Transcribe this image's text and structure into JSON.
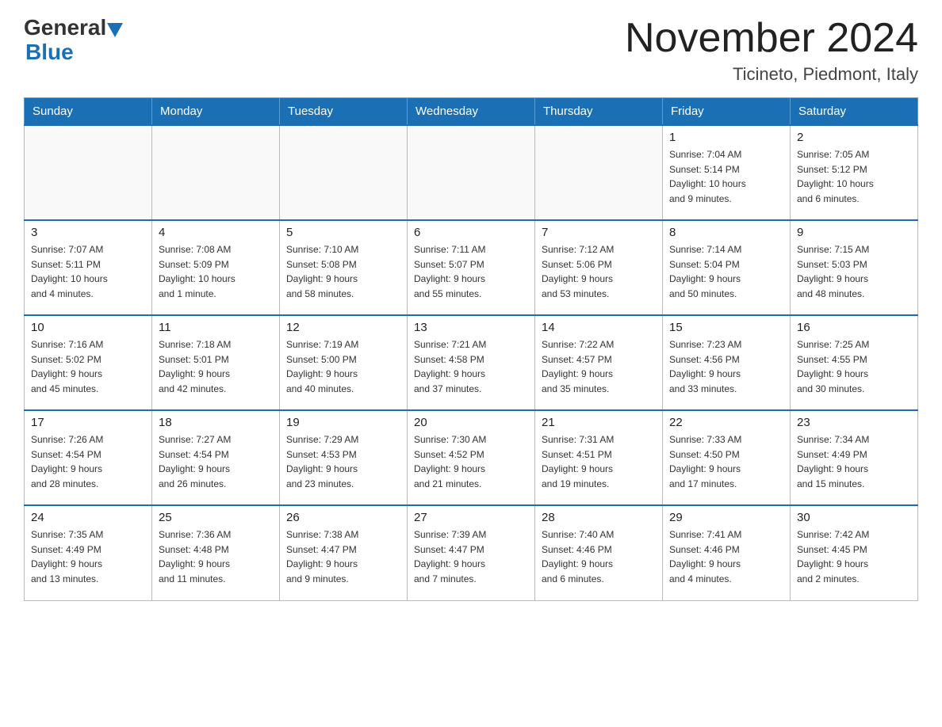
{
  "header": {
    "logo_general": "General",
    "logo_blue": "Blue",
    "main_title": "November 2024",
    "subtitle": "Ticineto, Piedmont, Italy"
  },
  "days_of_week": [
    "Sunday",
    "Monday",
    "Tuesday",
    "Wednesday",
    "Thursday",
    "Friday",
    "Saturday"
  ],
  "weeks": [
    [
      {
        "day": "",
        "info": ""
      },
      {
        "day": "",
        "info": ""
      },
      {
        "day": "",
        "info": ""
      },
      {
        "day": "",
        "info": ""
      },
      {
        "day": "",
        "info": ""
      },
      {
        "day": "1",
        "info": "Sunrise: 7:04 AM\nSunset: 5:14 PM\nDaylight: 10 hours\nand 9 minutes."
      },
      {
        "day": "2",
        "info": "Sunrise: 7:05 AM\nSunset: 5:12 PM\nDaylight: 10 hours\nand 6 minutes."
      }
    ],
    [
      {
        "day": "3",
        "info": "Sunrise: 7:07 AM\nSunset: 5:11 PM\nDaylight: 10 hours\nand 4 minutes."
      },
      {
        "day": "4",
        "info": "Sunrise: 7:08 AM\nSunset: 5:09 PM\nDaylight: 10 hours\nand 1 minute."
      },
      {
        "day": "5",
        "info": "Sunrise: 7:10 AM\nSunset: 5:08 PM\nDaylight: 9 hours\nand 58 minutes."
      },
      {
        "day": "6",
        "info": "Sunrise: 7:11 AM\nSunset: 5:07 PM\nDaylight: 9 hours\nand 55 minutes."
      },
      {
        "day": "7",
        "info": "Sunrise: 7:12 AM\nSunset: 5:06 PM\nDaylight: 9 hours\nand 53 minutes."
      },
      {
        "day": "8",
        "info": "Sunrise: 7:14 AM\nSunset: 5:04 PM\nDaylight: 9 hours\nand 50 minutes."
      },
      {
        "day": "9",
        "info": "Sunrise: 7:15 AM\nSunset: 5:03 PM\nDaylight: 9 hours\nand 48 minutes."
      }
    ],
    [
      {
        "day": "10",
        "info": "Sunrise: 7:16 AM\nSunset: 5:02 PM\nDaylight: 9 hours\nand 45 minutes."
      },
      {
        "day": "11",
        "info": "Sunrise: 7:18 AM\nSunset: 5:01 PM\nDaylight: 9 hours\nand 42 minutes."
      },
      {
        "day": "12",
        "info": "Sunrise: 7:19 AM\nSunset: 5:00 PM\nDaylight: 9 hours\nand 40 minutes."
      },
      {
        "day": "13",
        "info": "Sunrise: 7:21 AM\nSunset: 4:58 PM\nDaylight: 9 hours\nand 37 minutes."
      },
      {
        "day": "14",
        "info": "Sunrise: 7:22 AM\nSunset: 4:57 PM\nDaylight: 9 hours\nand 35 minutes."
      },
      {
        "day": "15",
        "info": "Sunrise: 7:23 AM\nSunset: 4:56 PM\nDaylight: 9 hours\nand 33 minutes."
      },
      {
        "day": "16",
        "info": "Sunrise: 7:25 AM\nSunset: 4:55 PM\nDaylight: 9 hours\nand 30 minutes."
      }
    ],
    [
      {
        "day": "17",
        "info": "Sunrise: 7:26 AM\nSunset: 4:54 PM\nDaylight: 9 hours\nand 28 minutes."
      },
      {
        "day": "18",
        "info": "Sunrise: 7:27 AM\nSunset: 4:54 PM\nDaylight: 9 hours\nand 26 minutes."
      },
      {
        "day": "19",
        "info": "Sunrise: 7:29 AM\nSunset: 4:53 PM\nDaylight: 9 hours\nand 23 minutes."
      },
      {
        "day": "20",
        "info": "Sunrise: 7:30 AM\nSunset: 4:52 PM\nDaylight: 9 hours\nand 21 minutes."
      },
      {
        "day": "21",
        "info": "Sunrise: 7:31 AM\nSunset: 4:51 PM\nDaylight: 9 hours\nand 19 minutes."
      },
      {
        "day": "22",
        "info": "Sunrise: 7:33 AM\nSunset: 4:50 PM\nDaylight: 9 hours\nand 17 minutes."
      },
      {
        "day": "23",
        "info": "Sunrise: 7:34 AM\nSunset: 4:49 PM\nDaylight: 9 hours\nand 15 minutes."
      }
    ],
    [
      {
        "day": "24",
        "info": "Sunrise: 7:35 AM\nSunset: 4:49 PM\nDaylight: 9 hours\nand 13 minutes."
      },
      {
        "day": "25",
        "info": "Sunrise: 7:36 AM\nSunset: 4:48 PM\nDaylight: 9 hours\nand 11 minutes."
      },
      {
        "day": "26",
        "info": "Sunrise: 7:38 AM\nSunset: 4:47 PM\nDaylight: 9 hours\nand 9 minutes."
      },
      {
        "day": "27",
        "info": "Sunrise: 7:39 AM\nSunset: 4:47 PM\nDaylight: 9 hours\nand 7 minutes."
      },
      {
        "day": "28",
        "info": "Sunrise: 7:40 AM\nSunset: 4:46 PM\nDaylight: 9 hours\nand 6 minutes."
      },
      {
        "day": "29",
        "info": "Sunrise: 7:41 AM\nSunset: 4:46 PM\nDaylight: 9 hours\nand 4 minutes."
      },
      {
        "day": "30",
        "info": "Sunrise: 7:42 AM\nSunset: 4:45 PM\nDaylight: 9 hours\nand 2 minutes."
      }
    ]
  ]
}
